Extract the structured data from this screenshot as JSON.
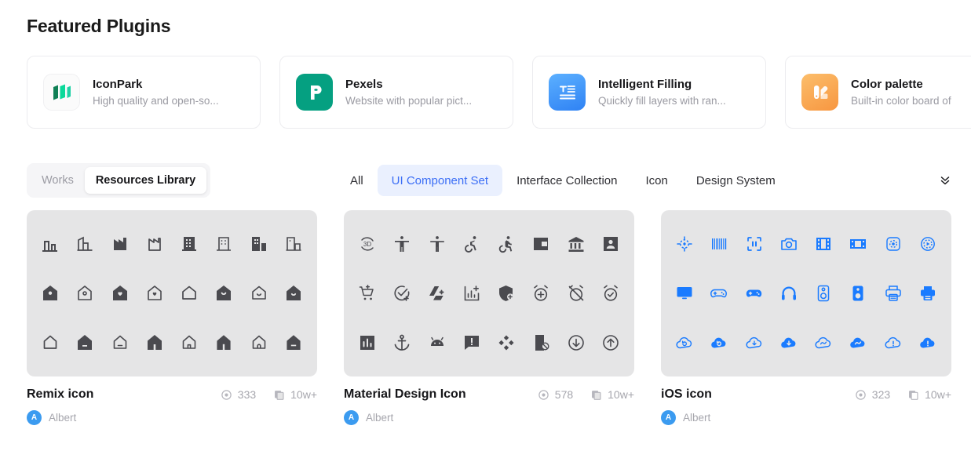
{
  "section": {
    "title": "Featured Plugins"
  },
  "plugins": [
    {
      "name": "IconPark",
      "desc": "High quality and open-so...",
      "logo": "iconpark-logo"
    },
    {
      "name": "Pexels",
      "desc": "Website with popular pict...",
      "logo": "pexels-logo"
    },
    {
      "name": "Intelligent Filling",
      "desc": "Quickly fill layers with ran...",
      "logo": "intelligent-filling-logo"
    },
    {
      "name": "Color palette",
      "desc": "Built-in color board of",
      "logo": "color-palette-logo"
    }
  ],
  "segmented": {
    "items": [
      {
        "label": "Works",
        "active": false
      },
      {
        "label": "Resources Library",
        "active": true
      }
    ]
  },
  "filters": {
    "items": [
      {
        "label": "All",
        "active": false
      },
      {
        "label": "UI Component Set",
        "active": true
      },
      {
        "label": "Interface Collection",
        "active": false
      },
      {
        "label": "Icon",
        "active": false
      },
      {
        "label": "Design System",
        "active": false
      }
    ],
    "expand_icon": "chevron-double-down-icon"
  },
  "resources": [
    {
      "title": "Remix icon",
      "views": "333",
      "uses": "10w+",
      "author": "Albert",
      "avatar_initial": "A",
      "icon_color": "#4a4a4f"
    },
    {
      "title": "Material Design Icon",
      "views": "578",
      "uses": "10w+",
      "author": "Albert",
      "avatar_initial": "A",
      "icon_color": "#4a4a4f"
    },
    {
      "title": "iOS icon",
      "views": "323",
      "uses": "10w+",
      "author": "Albert",
      "avatar_initial": "A",
      "icon_color": "#1a7bff"
    }
  ],
  "colors": {
    "accent_blue": "#3b6ef6",
    "filter_active_bg": "#eaf0fe",
    "ios_icon_blue": "#1a7bff",
    "grid_bg": "#e5e5e6",
    "muted_text": "#a6a6ad",
    "pexels_green": "#05a081",
    "filling_blue": "#4196f8",
    "palette_orange": "#f9a94a"
  },
  "stat_icons": {
    "views": "eye-icon",
    "uses": "copy-icon"
  }
}
